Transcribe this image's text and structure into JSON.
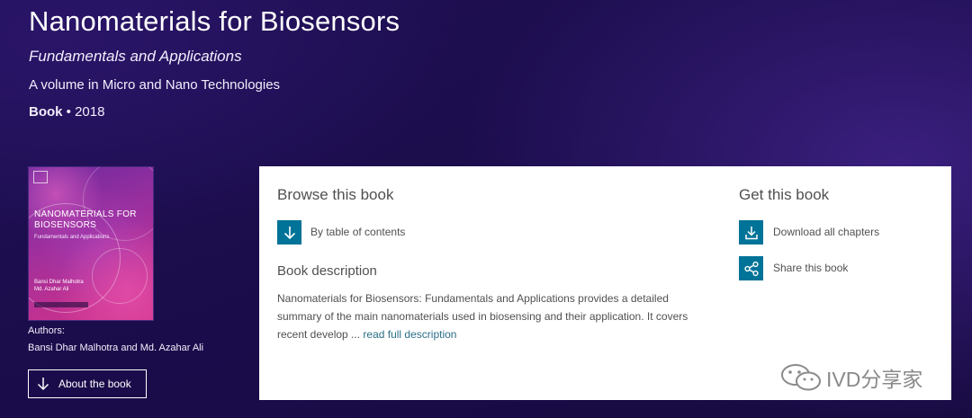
{
  "book": {
    "title": "Nanomaterials for Biosensors",
    "subtitle": "Fundamentals and Applications",
    "series": "A volume in Micro and Nano Technologies",
    "type": "Book",
    "separator": " • ",
    "year": "2018"
  },
  "cover": {
    "title_line1": "NANOMATERIALS FOR",
    "title_line2": "BIOSENSORS",
    "subtitle": "Fundamentals and Applications",
    "author_line1": "Bansi Dhar Malhotra",
    "author_line2": "Md. Azahar Ali"
  },
  "authors": {
    "label": "Authors:",
    "names": "Bansi Dhar Malhotra and Md. Azahar Ali"
  },
  "about_button": {
    "label": "About the book",
    "icon": "arrow-down-icon"
  },
  "browse": {
    "heading": "Browse this book",
    "toc_label": "By table of contents",
    "toc_icon": "arrow-down-icon"
  },
  "description": {
    "heading": "Book description",
    "text": "Nanomaterials for Biosensors: Fundamentals and Applications provides a detailed summary of the main nanomaterials used in biosensing and their application. It covers recent develop ...",
    "read_more": "read full description"
  },
  "get": {
    "heading": "Get this book",
    "download_label": "Download all chapters",
    "download_icon": "download-icon",
    "share_label": "Share this book",
    "share_icon": "share-icon"
  },
  "watermark": {
    "text": "IVD分享家",
    "icon": "wechat-icon"
  },
  "colors": {
    "background": "#1c0d4c",
    "accent": "#007398",
    "link": "#2a6f88",
    "panel": "#ffffff"
  }
}
